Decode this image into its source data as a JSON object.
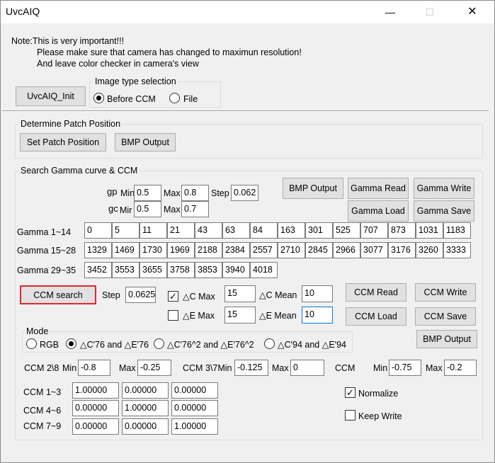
{
  "window": {
    "title": "UvcAIQ",
    "min_glyph": "—",
    "max_glyph": "☐",
    "close_glyph": "✕"
  },
  "note": {
    "line1": "Note:This is very important!!!",
    "line2": "Please make sure that camera has changed to maximun resolution!",
    "line3": "And leave color checker in camera's view"
  },
  "init_button": "UvcAIQ_Init",
  "image_type": {
    "title": "Image type selection",
    "opt1": "Before CCM",
    "opt2": "File",
    "selected": "Before CCM"
  },
  "patch": {
    "title": "Determine Patch Position",
    "set_btn": "Set Patch Position",
    "bmp_btn": "BMP Output"
  },
  "gamma_section": {
    "title": "Search Gamma curve & CCM",
    "gp_label": "gp",
    "gc_label": "gc",
    "min_label": "Min",
    "mir_label": "Mir",
    "max_label": "Max",
    "step_label": "Step",
    "gp_min": "0.5",
    "gp_max": "0.8",
    "step": "0.062",
    "gc_min": "0.5",
    "gc_max": "0.7",
    "bmp_btn": "BMP Output",
    "read_btn": "Gamma Read",
    "write_btn": "Gamma Write",
    "load_btn": "Gamma Load",
    "save_btn": "Gamma Save",
    "row1_label": "Gamma 1~14",
    "row2_label": "Gamma 15~28",
    "row3_label": "Gamma 29~35",
    "row1": [
      "0",
      "5",
      "11",
      "21",
      "43",
      "63",
      "84",
      "163",
      "301",
      "525",
      "707",
      "873",
      "1031",
      "1183"
    ],
    "row2": [
      "1329",
      "1469",
      "1730",
      "1969",
      "2188",
      "2384",
      "2557",
      "2710",
      "2845",
      "2966",
      "3077",
      "3176",
      "3260",
      "3333"
    ],
    "row3": [
      "3452",
      "3553",
      "3655",
      "3758",
      "3853",
      "3940",
      "4018"
    ]
  },
  "ccm": {
    "search_btn": "CCM search",
    "step_label": "Step",
    "step": "0.0625",
    "c_max_label": "△C Max",
    "c_max": "15",
    "c_max_checked": true,
    "c_mean_label": "△C Mean",
    "c_mean": "10",
    "e_max_label": "△E Max",
    "e_max": "15",
    "e_max_checked": false,
    "e_mean_label": "△E Mean",
    "e_mean": "10",
    "read_btn": "CCM Read",
    "write_btn": "CCM Write",
    "load_btn": "CCM Load",
    "save_btn": "CCM Save",
    "bmp_btn": "BMP Output",
    "mode_title": "Mode",
    "mode_opts": [
      "RGB",
      "△C'76 and △E'76",
      "△C'76^2 and △E'76^2",
      "△C'94 and △E'94"
    ],
    "mode_selected": "△C'76 and △E'76",
    "ccm28_label": "CCM 2\\8",
    "ccm37_label": "CCM 3\\7Min",
    "ccm_label": "CCM",
    "min_label": "Min",
    "max_label": "Max",
    "ccm28_min": "-0.8",
    "ccm28_max": "-0.25",
    "ccm37_min": "-0.125",
    "ccm37_max": "0",
    "ccm_min": "-0.75",
    "ccm_max": "-0.2",
    "r13_label": "CCM 1~3",
    "r46_label": "CCM 4~6",
    "r79_label": "CCM 7~9",
    "r13": [
      "1.00000",
      "0.00000",
      "0.00000"
    ],
    "r46": [
      "0.00000",
      "1.00000",
      "0.00000"
    ],
    "r79": [
      "0.00000",
      "0.00000",
      "1.00000"
    ],
    "normalize_label": "Normalize",
    "normalize_checked": true,
    "keep_write_label": "Keep Write",
    "keep_write_checked": false
  }
}
